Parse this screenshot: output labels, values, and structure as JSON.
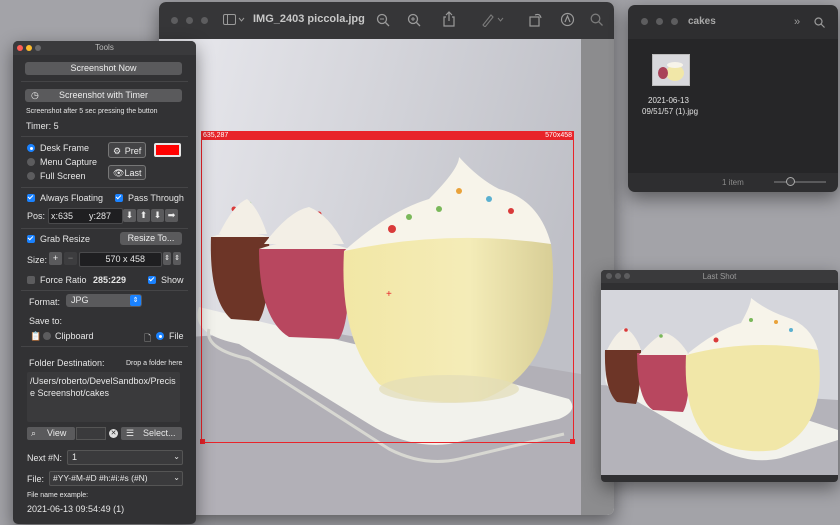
{
  "preview": {
    "title": "IMG_2403 piccola.jpg",
    "selection": {
      "position_label": "635,287",
      "size_label": "570x458"
    }
  },
  "finder": {
    "title": "cakes",
    "file_name_line1": "2021-06-13",
    "file_name_line2": "09/51/57 (1).jpg",
    "status": "1 item"
  },
  "lastshot": {
    "title": "Last Shot"
  },
  "tools": {
    "title": "Tools",
    "screenshot_now": "Screenshot Now",
    "screenshot_timer": "Screenshot with Timer",
    "timer_hint": "Screenshot after 5 sec pressing the button",
    "timer_label": "Timer: 5",
    "mode_desk_frame": "Desk Frame",
    "mode_menu_capture": "Menu Capture",
    "mode_full_screen": "Full Screen",
    "pref_label": "Pref",
    "frame_color": "#ff0000",
    "last_label": "Last",
    "always_floating": "Always Floating",
    "pass_through": "Pass Through",
    "pos_label": "Pos:",
    "pos_x": "x:635",
    "pos_y": "y:287",
    "grab_resize": "Grab Resize",
    "resize_to": "Resize To...",
    "size_label": "Size:",
    "size_value": "570 x 458",
    "force_ratio": "Force Ratio",
    "ratio_value": "285:229",
    "show_label": "Show",
    "format_label": "Format:",
    "format_value": "JPG",
    "save_to": "Save to:",
    "clipboard": "Clipboard",
    "file_option": "File",
    "folder_destination": "Folder Destination:",
    "drop_hint": "Drop a folder here",
    "folder_path": "/Users/roberto/DevelSandbox/Precise Screenshot/cakes",
    "view_label": "View",
    "select_label": "Select...",
    "next_label": "Next #N:",
    "next_value": "1",
    "file_label": "File:",
    "file_pattern": "#YY-#M-#D #h:#i:#s (#N)",
    "example_label": "File name example:",
    "example_value": "2021-06-13 09:54:49 (1)"
  }
}
